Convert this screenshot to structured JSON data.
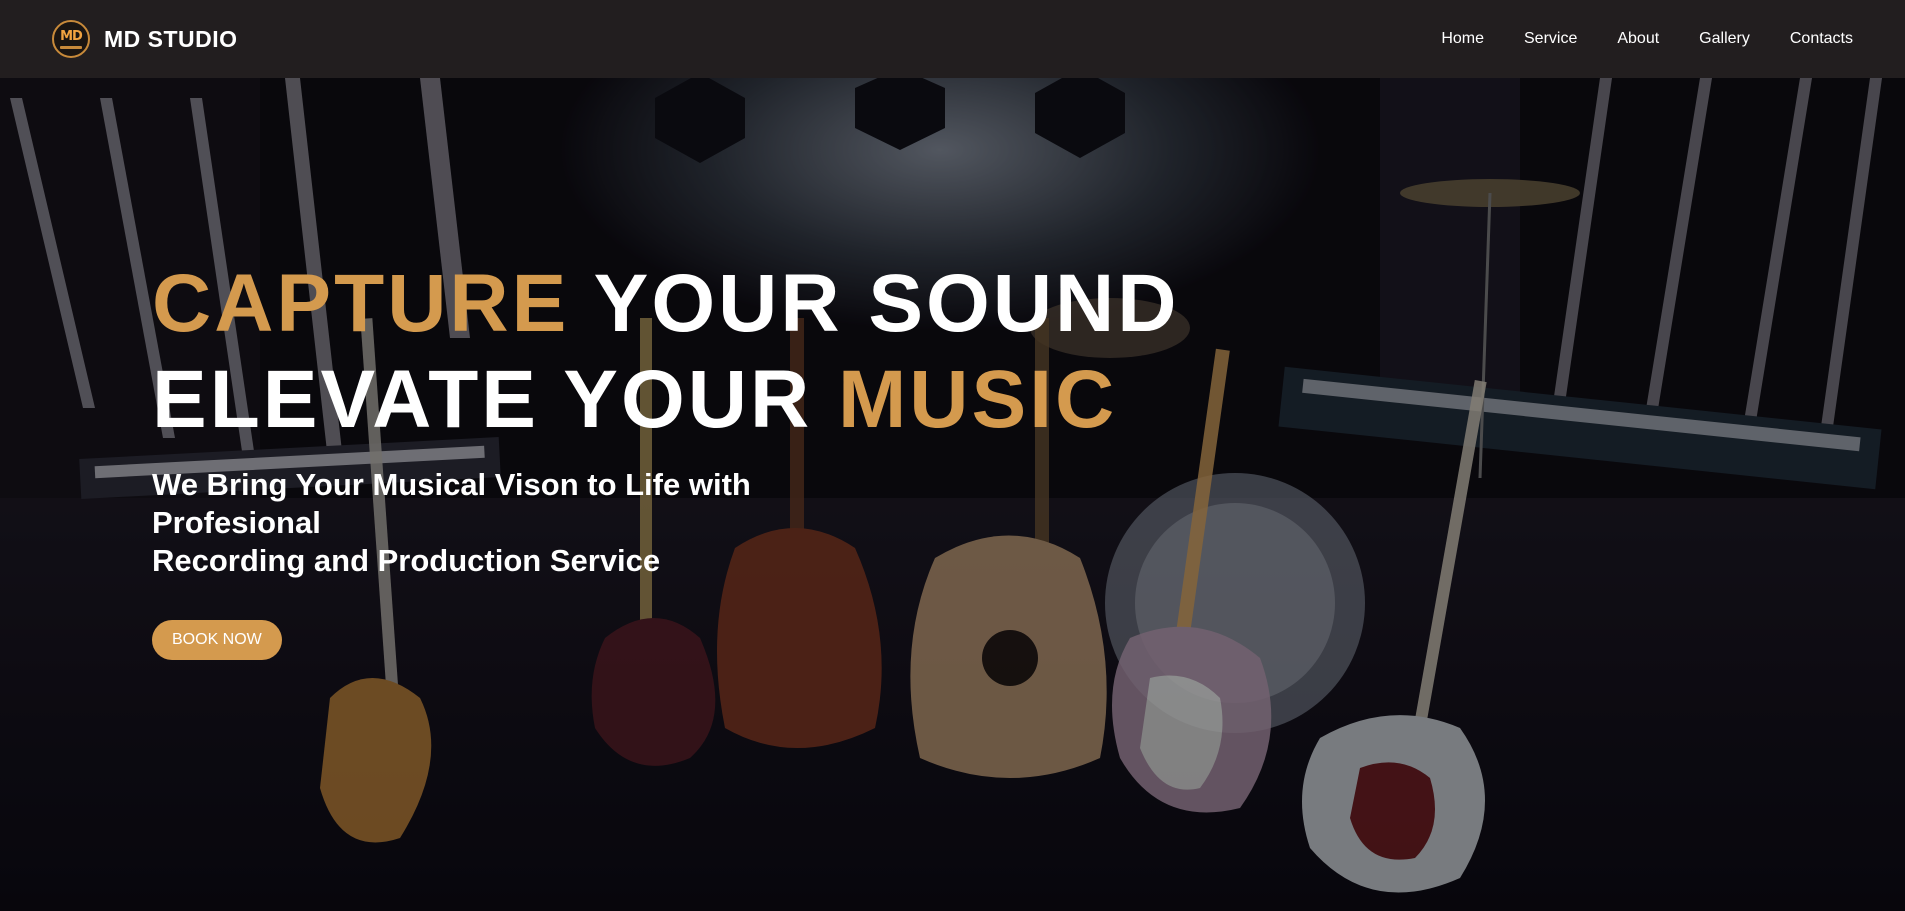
{
  "brand": {
    "name": "MD STUDIO",
    "logo_text": "MD"
  },
  "nav": {
    "items": [
      {
        "label": "Home"
      },
      {
        "label": "Service"
      },
      {
        "label": "About"
      },
      {
        "label": "Gallery"
      },
      {
        "label": "Contacts"
      }
    ]
  },
  "hero": {
    "line1_accent": "CAPTURE",
    "line1_rest": " YOUR SOUND",
    "line2_rest": "ELEVATE YOUR ",
    "line2_accent": "MUSIC",
    "sub_line1": "We Bring Your Musical Vison to Life with Profesional",
    "sub_line2": "Recording and Production Service",
    "cta_label": "BOOK NOW"
  },
  "colors": {
    "accent": "#d49a4e",
    "nav_bg": "#221e1f",
    "text": "#ffffff"
  }
}
